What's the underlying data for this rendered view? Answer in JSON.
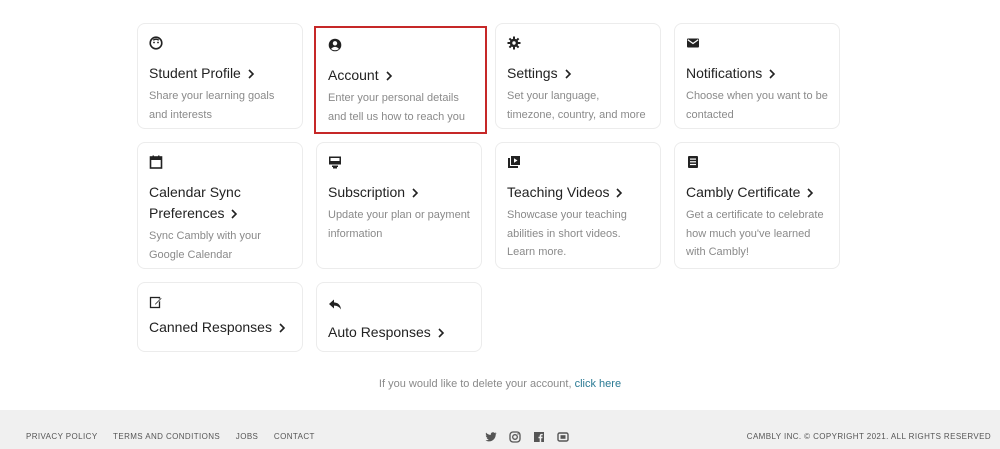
{
  "cards": {
    "student_profile": {
      "title": "Student Profile",
      "desc": "Share your learning goals and interests",
      "icon": "smile-face-icon"
    },
    "account": {
      "title": "Account",
      "desc": "Enter your personal details and tell us how to reach you",
      "icon": "user-circle-icon"
    },
    "settings": {
      "title": "Settings",
      "desc": "Set your language, timezone, country, and more",
      "icon": "gear-icon"
    },
    "notifications": {
      "title": "Notifications",
      "desc": "Choose when you want to be contacted",
      "icon": "envelope-icon"
    },
    "calendar_sync": {
      "title_line1": "Calendar Sync",
      "title_line2": "Preferences",
      "desc": "Sync Cambly with your Google Calendar",
      "icon": "calendar-icon"
    },
    "subscription": {
      "title": "Subscription",
      "desc": "Update your plan or payment information",
      "icon": "monitor-icon"
    },
    "teaching_videos": {
      "title": "Teaching Videos",
      "desc": "Showcase your teaching abilities in short videos. Learn more.",
      "icon": "video-library-icon"
    },
    "certificate": {
      "title": "Cambly Certificate",
      "desc": "Get a certificate to celebrate how much you've learned with Cambly!",
      "icon": "document-icon"
    },
    "canned_responses": {
      "title": "Canned Responses",
      "icon": "edit-icon"
    },
    "auto_responses": {
      "title": "Auto Responses",
      "icon": "reply-icon"
    }
  },
  "delete_account": {
    "text": "If you would like to delete your account,",
    "link": "click here"
  },
  "footer": {
    "links": [
      "PRIVACY POLICY",
      "TERMS AND CONDITIONS",
      "JOBS",
      "CONTACT"
    ],
    "social": [
      "twitter-icon",
      "instagram-icon",
      "facebook-icon",
      "youtube-icon"
    ],
    "copyright": "CAMBLY INC. © COPYRIGHT 2021. ALL RIGHTS RESERVED"
  },
  "colors": {
    "selected_border": "#c62828",
    "link": "#2a7a94",
    "muted_text": "#8a8a8a"
  }
}
